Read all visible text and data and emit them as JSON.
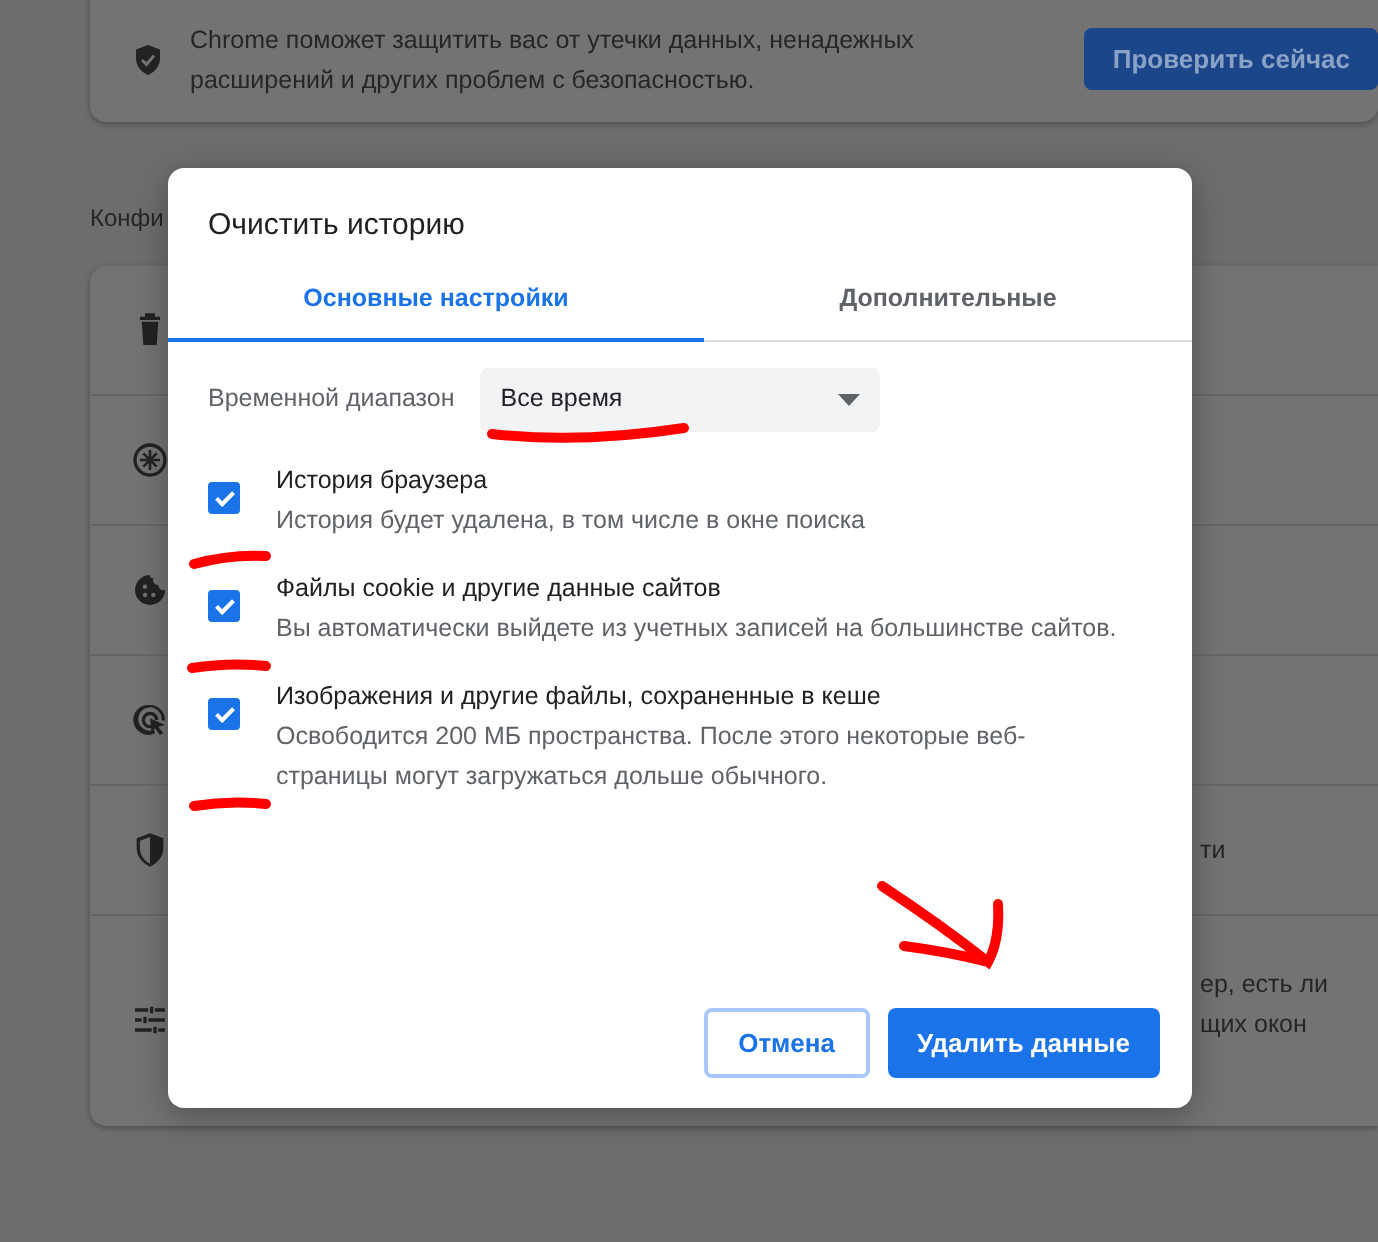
{
  "page": {
    "security_card": {
      "text": "Chrome поможет защитить вас от утечки данных, ненадежных расширений и других проблем с безопасностью.",
      "button": "Проверить сейчас"
    },
    "section_heading": "Конфи",
    "rows": [
      {
        "kind": "trash"
      },
      {
        "kind": "sync"
      },
      {
        "kind": "cookie"
      },
      {
        "kind": "cursor"
      },
      {
        "kind": "shield",
        "texts": [
          "ти"
        ]
      },
      {
        "kind": "sliders",
        "texts": [
          "ер, есть ли",
          "щих окон"
        ]
      }
    ]
  },
  "dialog": {
    "title": "Очистить историю",
    "tabs": [
      {
        "label": "Основные настройки",
        "selected": true
      },
      {
        "label": "Дополнительные",
        "selected": false
      }
    ],
    "time_range": {
      "label": "Временной диапазон",
      "value": "Все время"
    },
    "options": [
      {
        "title": "История браузера",
        "description": "История будет удалена, в том числе в окне поиска",
        "checked": true
      },
      {
        "title": "Файлы cookie и другие данные сайтов",
        "description": "Вы автоматически выйдете из учетных записей на большинстве сайтов.",
        "checked": true
      },
      {
        "title": "Изображения и другие файлы, сохраненные в кеше",
        "description": "Освободится 200 МБ пространства. После этого некоторые веб-страницы могут загружаться дольше обычного.",
        "checked": true
      }
    ],
    "cancel_button": "Отмена",
    "confirm_button": "Удалить данные"
  }
}
